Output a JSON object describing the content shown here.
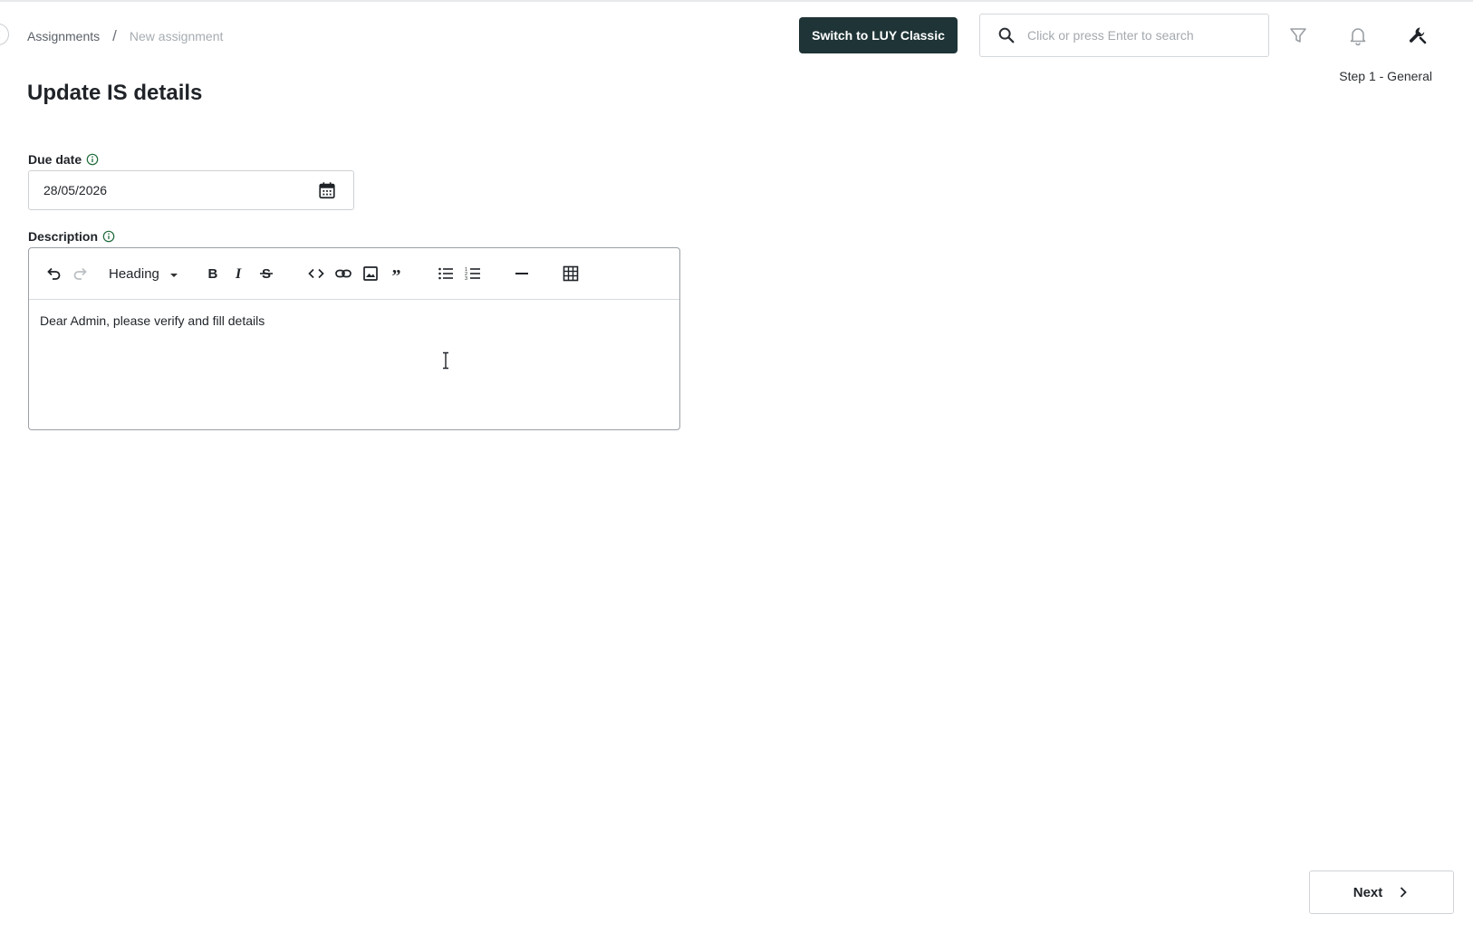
{
  "breadcrumb": {
    "items": [
      "Assignments",
      "New assignment"
    ],
    "separator": "/"
  },
  "header": {
    "switch_button_label": "Switch to LUY Classic",
    "search_placeholder": "Click or press Enter to search",
    "icons": [
      "search-icon",
      "filter-icon",
      "bell-icon",
      "wrench-icon"
    ],
    "switch_button_color": "#1f3436"
  },
  "step": {
    "label": "Step 1 - General"
  },
  "page": {
    "title": "Update IS details"
  },
  "due_date": {
    "label": "Due date",
    "value": "28/05/2026"
  },
  "description": {
    "label": "Description",
    "heading_select": "Heading",
    "content": "Dear Admin, please verify and fill details",
    "toolbar_icons": [
      "undo-icon",
      "redo-icon",
      "bold-icon",
      "italic-icon",
      "strikethrough-icon",
      "code-icon",
      "link-icon",
      "image-icon",
      "quote-icon",
      "bullet-list-icon",
      "numbered-list-icon",
      "horizontal-rule-icon",
      "table-icon"
    ]
  },
  "footer": {
    "next_label": "Next"
  }
}
